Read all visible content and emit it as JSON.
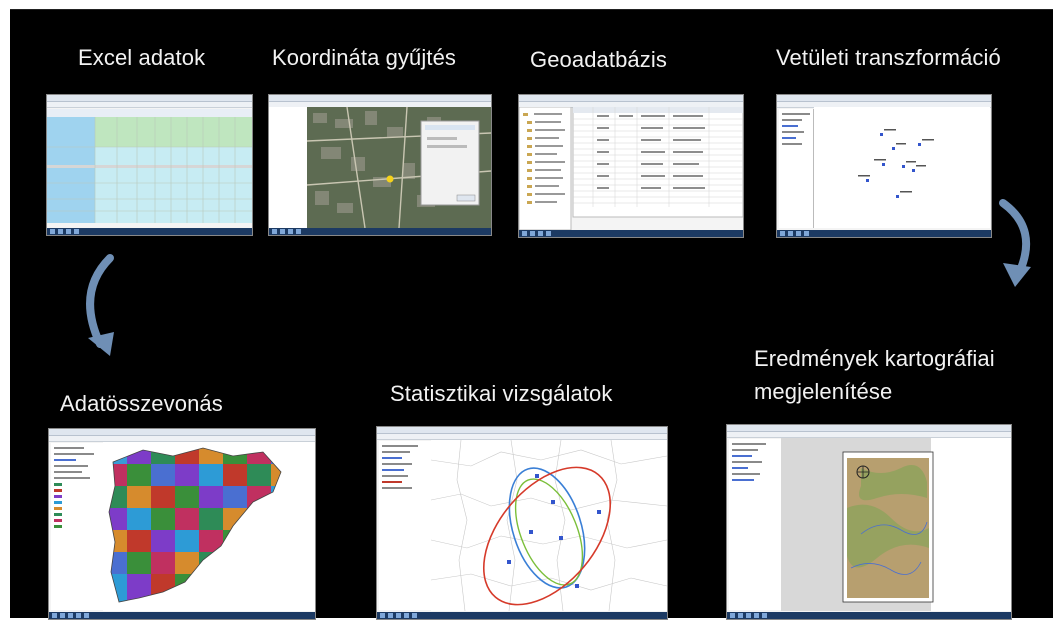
{
  "slide": {
    "titles": {
      "excel": "Excel adatok",
      "koordinata": "Koordináta gyűjtés",
      "geoadatbazis": "Geoadatbázis",
      "vetuleti": "Vetületi transzformáció",
      "adatosszevonas": "Adatösszevonás",
      "statisztikai": "Statisztikai vizsgálatok",
      "eredmenyek_line1": "Eredmények kartográfiai",
      "eredmenyek_line2": "megjelenítése"
    },
    "steps": [
      {
        "id": "excel",
        "thumbnail": "spreadsheet-screenshot"
      },
      {
        "id": "koordinata",
        "thumbnail": "satellite-map-screenshot"
      },
      {
        "id": "geoadatbazis",
        "thumbnail": "database-table-screenshot"
      },
      {
        "id": "vetuleti",
        "thumbnail": "point-layer-screenshot"
      },
      {
        "id": "adatosszevonas",
        "thumbnail": "choropleth-map-screenshot"
      },
      {
        "id": "statisztikai",
        "thumbnail": "ellipse-analysis-screenshot"
      },
      {
        "id": "eredmenyek",
        "thumbnail": "cartographic-layout-screenshot"
      }
    ],
    "colors": {
      "background": "#000000",
      "text": "#f2f2f2",
      "arrow": "#6f8fb5"
    },
    "icons": [
      "curved-arrow-left-icon",
      "curved-arrow-right-icon"
    ]
  }
}
